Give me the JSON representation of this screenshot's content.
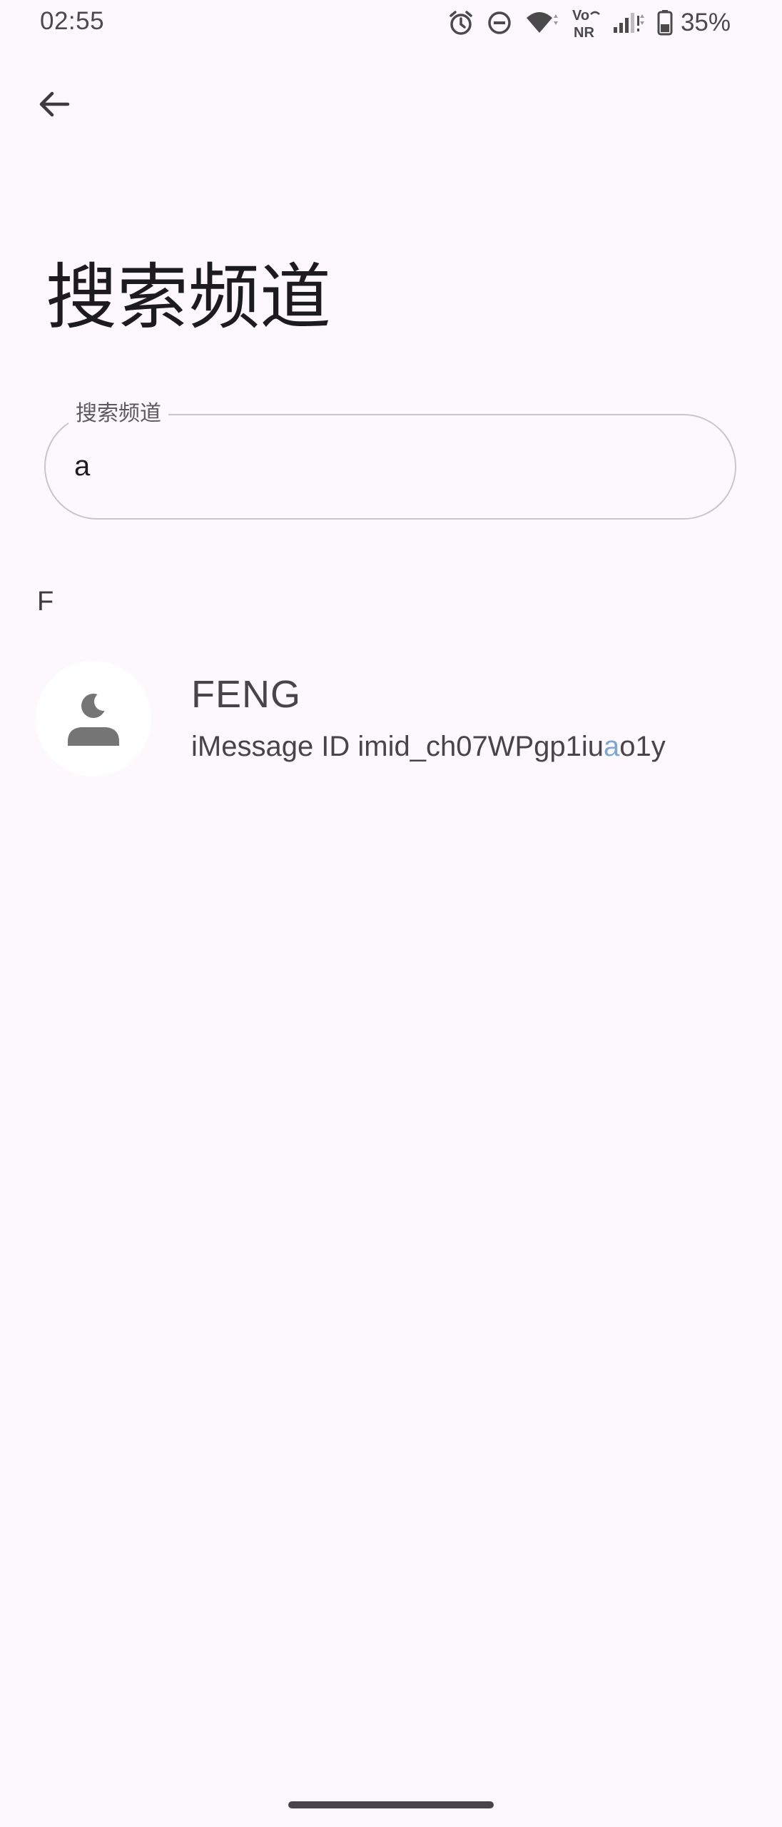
{
  "status_bar": {
    "time": "02:55",
    "battery_percent": "35%",
    "icons": [
      "alarm-icon",
      "do-not-disturb-icon",
      "wifi-icon",
      "vonr-icon",
      "cellular-signal-icon",
      "battery-icon"
    ],
    "vo_label": "Vo",
    "nr_label": "NR"
  },
  "header": {
    "back_icon": "arrow-back-icon",
    "title": "搜索频道"
  },
  "search": {
    "label": "搜索频道",
    "value": "a"
  },
  "results": {
    "section_letter": "F",
    "items": [
      {
        "name": "FENG",
        "detail_prefix": "iMessage ID  imid_ch07WPgp1iu",
        "detail_match": "a",
        "detail_suffix": "o1y",
        "avatar_icon": "person-icon"
      }
    ]
  },
  "colors": {
    "background": "#fcf8fc",
    "highlight": "#7aa6d8",
    "text_primary": "#1c1b1f",
    "text_secondary": "#47454a"
  }
}
